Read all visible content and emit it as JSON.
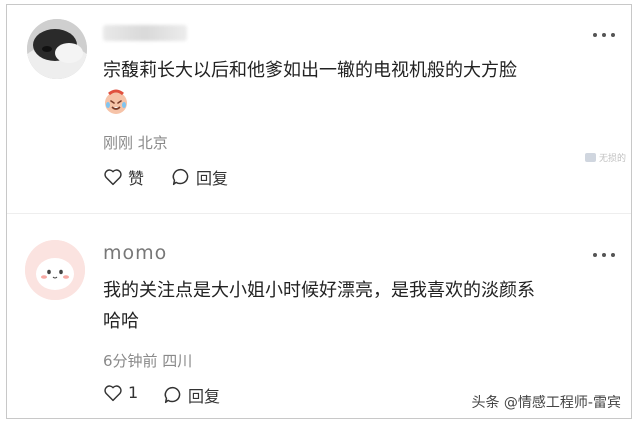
{
  "comments": [
    {
      "username": "",
      "text_lines": [
        "宗馥莉长大以后和他爹如出一辙的电视机般的大方脸"
      ],
      "emoji": "crying-laughing-face",
      "meta": "刚刚 北京",
      "like_label": "赞",
      "reply_label": "回复"
    },
    {
      "username": "momo",
      "text_lines": [
        "我的关注点是大小姐小时候好漂亮，是我喜欢的淡颜系",
        "哈哈"
      ],
      "meta": "6分钟前 四川",
      "like_label": "1",
      "reply_label": "回复"
    }
  ],
  "watermark_top": "无损的",
  "watermark": "头条 @情感工程师-雷宾",
  "icons": [
    "more-icon",
    "heart-icon",
    "comment-icon"
  ]
}
